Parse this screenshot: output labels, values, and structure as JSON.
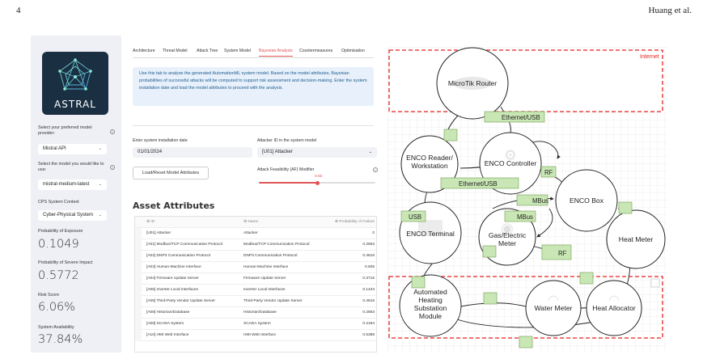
{
  "header": {
    "page_number": "4",
    "authors": "Huang et al."
  },
  "sidebar": {
    "logo_text": "ASTRAL",
    "provider_label": "Select your preferred model provider:",
    "provider_value": "Mistral API",
    "model_label": "Select the model you would like to use:",
    "model_value": "mistral-medium-latest",
    "context_label": "CPS System Context",
    "context_value": "Cyber-Physical System",
    "metrics": [
      {
        "label": "Probability of Exposure",
        "value": "0.1049"
      },
      {
        "label": "Probability of Severe Impact",
        "value": "0.5772"
      },
      {
        "label": "Risk Score",
        "value": "6.06%"
      },
      {
        "label": "System Availability",
        "value": "37.84%"
      }
    ]
  },
  "tabs": [
    "Architecture",
    "Threat Model",
    "Attack Tree",
    "System Model",
    "Bayesian Analysis",
    "Countermeasures",
    "Optimisation"
  ],
  "active_tab": "Bayesian Analysis",
  "info_text": "Use this tab to analyse the generated AutomationML system model. Based on the model attributes, Bayesian probabilities of successful attacks will be computed to support risk assessment and decision-making. Enter the system installation date and load the model attributes to proceed with the analysis.",
  "form": {
    "date_label": "Enter system installation date",
    "date_value": "01/01/2024",
    "attacker_label": "Attacker ID in the system model",
    "attacker_value": "[U01] Attacker",
    "load_button": "Load/Reset Model Attributes",
    "af_label": "Attack Feasibility (AF) Modifier",
    "af_value": "0.50",
    "af_level": 0.5
  },
  "asset_attributes": {
    "title": "Asset Attributes",
    "columns": [
      "ID",
      "Name",
      "Probability of Failure"
    ],
    "rows": [
      [
        "[U01] Attacker",
        "Attacker",
        "0"
      ],
      [
        "[A01] Modbus/TCP Communication Protocol",
        "Modbus/TCP Communication Protocol",
        "0.2663"
      ],
      [
        "[A02] DNP3 Communication Protocol",
        "DNP3 Communication Protocol",
        "0.4616"
      ],
      [
        "[A03] Human-Machine Interface",
        "Human-Machine Interface",
        "0.605"
      ],
      [
        "[A04] Firmware Update Server",
        "Firmware Update Server",
        "0.3715"
      ],
      [
        "[A05] Inverter Local Interfaces",
        "Inverter Local Interfaces",
        "0.1434"
      ],
      [
        "[A06] Third-Party Vendor Update Server",
        "Third-Party Vendor Update Server",
        "0.4616"
      ],
      [
        "[A08] Historian/Database",
        "Historian/Database",
        "0.2663"
      ],
      [
        "[A09] SCADA System",
        "SCADA System",
        "0.2194"
      ],
      [
        "[A10] HMI Web Interface",
        "HMI Web Interface",
        "0.5388"
      ]
    ]
  },
  "diagram": {
    "zone_internet": "Internet",
    "nodes": [
      "MicroTik Router",
      "ENCO Reader/\nWorkstation",
      "ENCO Controller",
      "ENCO Box",
      "ENCO Terminal",
      "Gas/Electric\nMeter",
      "Heat Meter",
      "Automated\nHeating\nSubstation\nModule",
      "Water Meter",
      "Heat Allocator"
    ],
    "edge_labels": [
      "Ethernet/USB",
      "RF",
      "Ethernet/USB",
      "MBus",
      "MBus",
      "USB",
      "RF"
    ]
  },
  "colors": {
    "accent": "#e05555",
    "info_bg": "#e8f1fb",
    "info_text": "#1c5a8f",
    "sidebar_bg": "#eef0f5",
    "logo_bg": "#1b2f43",
    "edge_label_bg": "#c9e7b4",
    "zone_border": "#e52222"
  }
}
